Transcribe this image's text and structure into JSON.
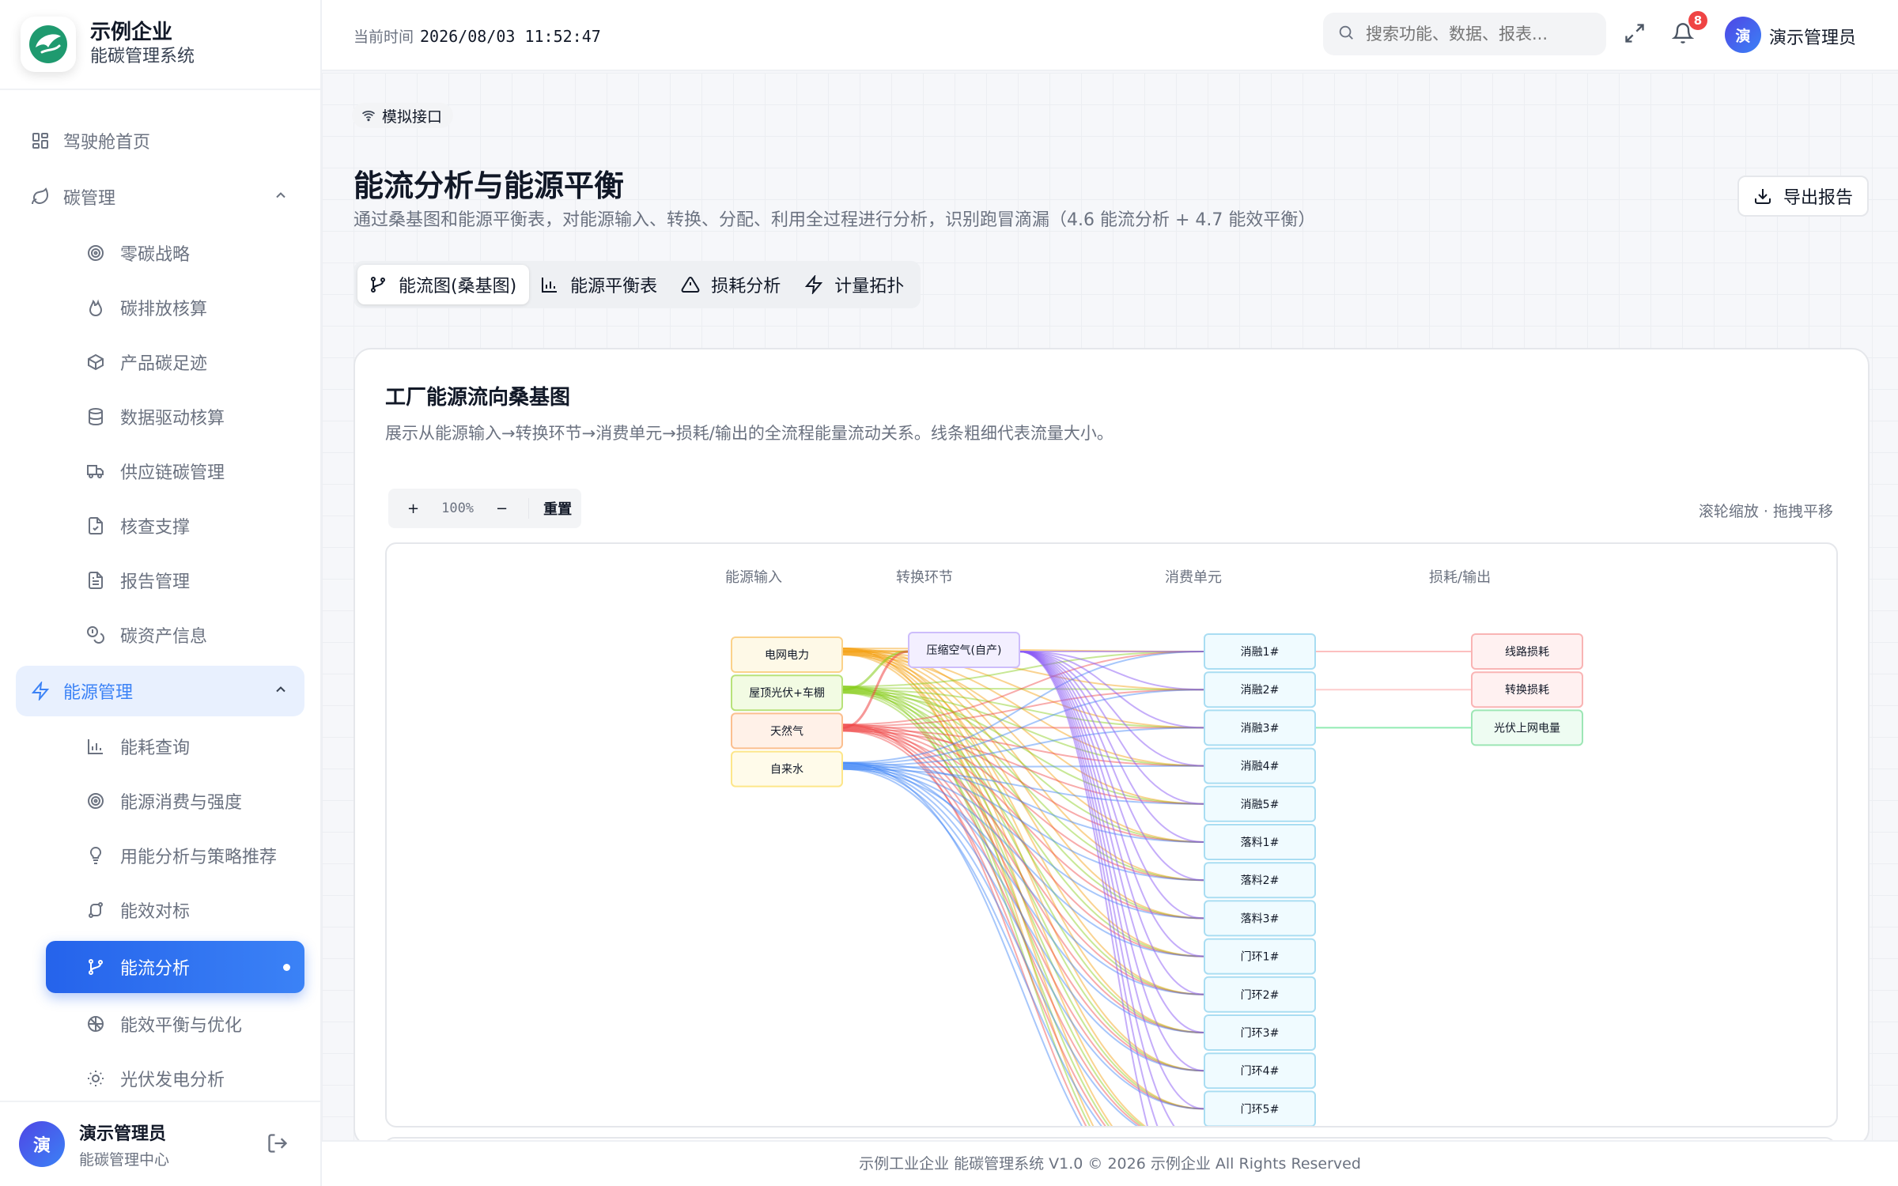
{
  "brand": {
    "title": "示例企业",
    "subtitle": "能碳管理系统"
  },
  "sidebar": {
    "items": [
      {
        "label": "驾驶舱首页",
        "icon": "grid-icon",
        "level": "top"
      },
      {
        "label": "碳管理",
        "icon": "leaf-icon",
        "level": "group",
        "expanded": true
      },
      {
        "label": "零碳战略",
        "icon": "target-icon",
        "level": "sub"
      },
      {
        "label": "碳排放核算",
        "icon": "flame-icon",
        "level": "sub"
      },
      {
        "label": "产品碳足迹",
        "icon": "box-icon",
        "level": "sub"
      },
      {
        "label": "数据驱动核算",
        "icon": "database-icon",
        "level": "sub"
      },
      {
        "label": "供应链碳管理",
        "icon": "truck-icon",
        "level": "sub"
      },
      {
        "label": "核查支撑",
        "icon": "file-check-icon",
        "level": "sub"
      },
      {
        "label": "报告管理",
        "icon": "file-text-icon",
        "level": "sub"
      },
      {
        "label": "碳资产信息",
        "icon": "coins-icon",
        "level": "sub"
      },
      {
        "label": "能源管理",
        "icon": "bolt-icon",
        "level": "group",
        "expanded": true,
        "active": true
      },
      {
        "label": "能耗查询",
        "icon": "bar-chart-icon",
        "level": "sub"
      },
      {
        "label": "能源消费与强度",
        "icon": "target-icon",
        "level": "sub"
      },
      {
        "label": "用能分析与策略推荐",
        "icon": "bulb-icon",
        "level": "sub"
      },
      {
        "label": "能效对标",
        "icon": "route-icon",
        "level": "sub"
      },
      {
        "label": "能流分析",
        "icon": "branch-icon",
        "level": "sub",
        "current": true
      },
      {
        "label": "能效平衡与优化",
        "icon": "scale-icon",
        "level": "sub"
      },
      {
        "label": "光伏发电分析",
        "icon": "sun-icon",
        "level": "sub"
      }
    ]
  },
  "user": {
    "avatar": "演",
    "name": "演示管理员",
    "role": "能碳管理中心"
  },
  "header": {
    "time_label": "当前时间",
    "time_value": "2026/08/03 11:52:47",
    "search_placeholder": "搜索功能、数据、报表...",
    "notification_count": "8",
    "user_avatar": "演",
    "user_name": "演示管理员"
  },
  "page": {
    "tag": "模拟接口",
    "title": "能流分析与能源平衡",
    "description": "通过桑基图和能源平衡表，对能源输入、转换、分配、利用全过程进行分析，识别跑冒滴漏（4.6 能流分析 + 4.7 能效平衡）",
    "export_label": "导出报告",
    "tabs": [
      {
        "label": "能流图(桑基图)",
        "icon": "branch-icon",
        "active": true
      },
      {
        "label": "能源平衡表",
        "icon": "bar-chart-icon"
      },
      {
        "label": "损耗分析",
        "icon": "warning-icon"
      },
      {
        "label": "计量拓扑",
        "icon": "bolt-icon"
      }
    ]
  },
  "card": {
    "title": "工厂能源流向桑基图",
    "description": "展示从能源输入→转换环节→消费单元→损耗/输出的全流程能量流动关系。线条粗细代表流量大小。",
    "zoom_in": "+",
    "zoom_level": "100%",
    "zoom_out": "−",
    "reset": "重置",
    "hint": "滚轮缩放 · 拖拽平移"
  },
  "sankey": {
    "columns": [
      "能源输入",
      "转换环节",
      "消费单元",
      "损耗/输出"
    ],
    "sources": [
      {
        "name": "电网电力",
        "color": "#f59e0b"
      },
      {
        "name": "屋顶光伏+车棚",
        "color": "#84cc16"
      },
      {
        "name": "天然气",
        "color": "#ef4444"
      },
      {
        "name": "自来水",
        "color": "#3b82f6"
      }
    ],
    "conversion": [
      {
        "name": "压缩空气(自产)",
        "color": "#8b5cf6"
      }
    ],
    "consumers": [
      "消融1#",
      "消融2#",
      "消融3#",
      "消融4#",
      "消融5#",
      "落料1#",
      "落料2#",
      "落料3#",
      "门环1#",
      "门环2#",
      "门环3#",
      "门环4#",
      "门环5#"
    ],
    "outputs": [
      {
        "name": "线路损耗",
        "kind": "loss"
      },
      {
        "name": "转换损耗",
        "kind": "loss"
      },
      {
        "name": "光伏上网电量",
        "kind": "export"
      }
    ]
  },
  "footer": {
    "text": "示例工业企业 能碳管理系统 V1.0 © 2026 示例企业 All Rights Reserved"
  }
}
